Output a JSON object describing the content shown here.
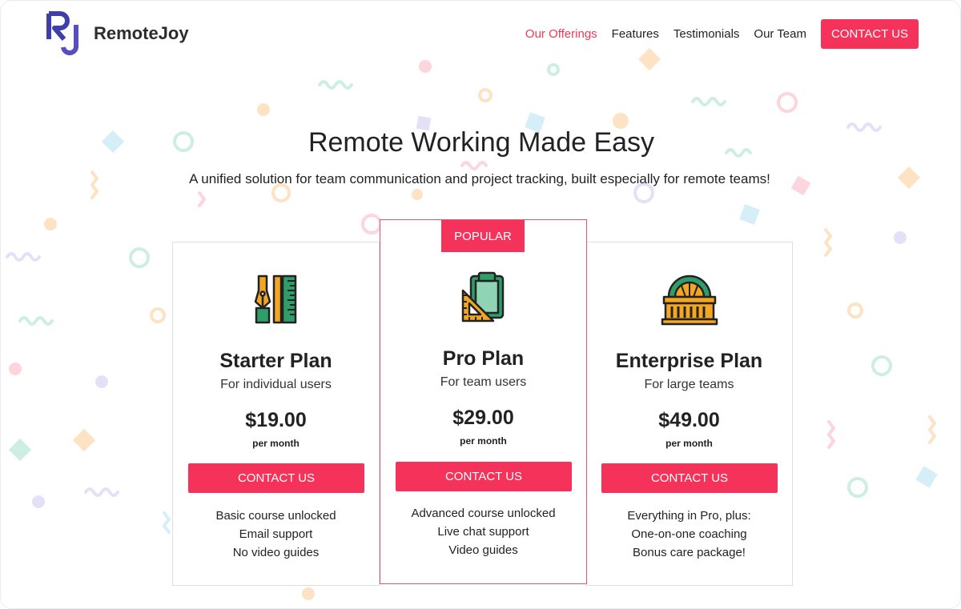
{
  "brand": {
    "name": "RemoteJoy",
    "logo_letters": "RJ",
    "accent_color": "#f5335a",
    "logo_color": "#4b3fb5"
  },
  "nav": {
    "items": [
      {
        "label": "Our Offerings",
        "active": true
      },
      {
        "label": "Features",
        "active": false
      },
      {
        "label": "Testimonials",
        "active": false
      },
      {
        "label": "Our Team",
        "active": false
      }
    ],
    "cta_label": "CONTACT US"
  },
  "hero": {
    "title": "Remote Working Made Easy",
    "subtitle": "A unified solution for team communication and project tracking, built especially for remote teams!"
  },
  "plans": [
    {
      "icon": "pen-ruler-icon",
      "name": "Starter Plan",
      "description": "For individual users",
      "price": "$19.00",
      "period": "per month",
      "cta_label": "CONTACT US",
      "features": [
        "Basic course unlocked",
        "Email support",
        "No video guides"
      ]
    },
    {
      "badge": "POPULAR",
      "icon": "clipboard-set-square-icon",
      "name": "Pro Plan",
      "description": "For team users",
      "price": "$29.00",
      "period": "per month",
      "cta_label": "CONTACT US",
      "features": [
        "Advanced course unlocked",
        "Live chat support",
        "Video guides"
      ]
    },
    {
      "icon": "building-icon",
      "name": "Enterprise Plan",
      "description": "For large teams",
      "price": "$49.00",
      "period": "per month",
      "cta_label": "CONTACT US",
      "features": [
        "Everything in Pro, plus:",
        "One-on-one coaching",
        "Bonus care package!"
      ]
    }
  ]
}
